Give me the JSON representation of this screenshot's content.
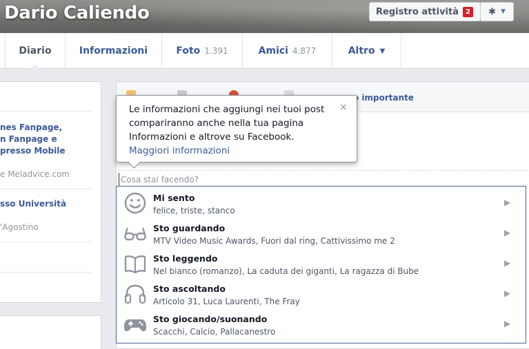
{
  "profile": {
    "name": "Dario Caliendo"
  },
  "header_actions": {
    "activity_label": "Registro attività",
    "activity_badge": "2"
  },
  "nav": {
    "tabs": [
      {
        "label": "Diario",
        "count": ""
      },
      {
        "label": "Informazioni",
        "count": ""
      },
      {
        "label": "Foto",
        "count": "1.391"
      },
      {
        "label": "Amici",
        "count": "4.877"
      },
      {
        "label": "Altro",
        "count": ""
      }
    ]
  },
  "left": {
    "lines": [
      "nes Fanpage,",
      "n Fanpage e",
      "presso Mobile",
      "e Meladvice.com",
      "sso Università",
      "'Agostino"
    ]
  },
  "composer": {
    "bar_label": "o importante",
    "placeholder": "Cosa stai facendo?"
  },
  "tooltip": {
    "text": "Le informazioni che aggiungi nei tuoi post compariranno anche nella tua pagina Informazioni e altrove su Facebook.",
    "link": "Maggiori informazioni",
    "close": "×"
  },
  "activities": [
    {
      "title": "Mi sento",
      "subtitle": "felice, triste, stanco",
      "icon": "smiley-icon"
    },
    {
      "title": "Sto guardando",
      "subtitle": "MTV Video Music Awards, Fuori dal ring, Cattivissimo me 2",
      "icon": "glasses-icon"
    },
    {
      "title": "Sto leggendo",
      "subtitle": "Nel bianco (romanzo), La caduta dei giganti, La ragazza di Bube",
      "icon": "book-icon"
    },
    {
      "title": "Sto ascoltando",
      "subtitle": "Articolo 31, Luca Laurenti, The Fray",
      "icon": "headphones-icon"
    },
    {
      "title": "Sto giocando/suonando",
      "subtitle": "Scacchi, Calcio, Pallacanestro",
      "icon": "gamepad-icon"
    }
  ],
  "colors": {
    "link": "#3b5998",
    "badge": "#d8202b",
    "list_border": "#4d6195"
  }
}
